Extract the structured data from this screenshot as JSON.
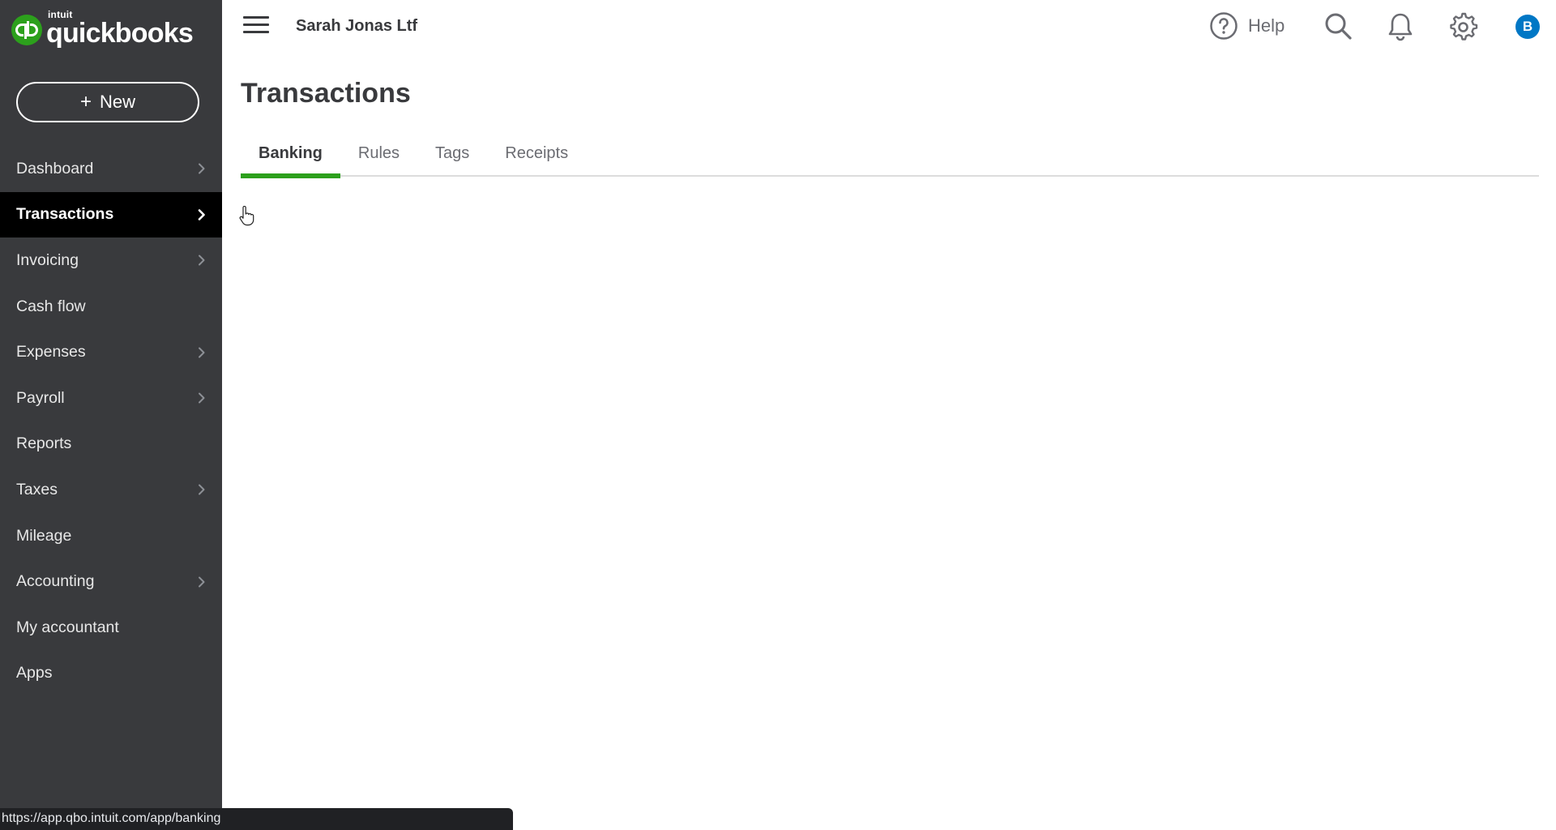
{
  "logo": {
    "small": "intuit",
    "word": "quickbooks"
  },
  "sidebar": {
    "new_label": "New",
    "items": [
      {
        "label": "Dashboard",
        "has_chevron": true
      },
      {
        "label": "Transactions",
        "has_chevron": true,
        "active": true
      },
      {
        "label": "Invoicing",
        "has_chevron": true
      },
      {
        "label": "Cash flow",
        "has_chevron": false
      },
      {
        "label": "Expenses",
        "has_chevron": true
      },
      {
        "label": "Payroll",
        "has_chevron": true
      },
      {
        "label": "Reports",
        "has_chevron": false
      },
      {
        "label": "Taxes",
        "has_chevron": true
      },
      {
        "label": "Mileage",
        "has_chevron": false
      },
      {
        "label": "Accounting",
        "has_chevron": true
      },
      {
        "label": "My accountant",
        "has_chevron": false
      },
      {
        "label": "Apps",
        "has_chevron": false
      }
    ]
  },
  "header": {
    "company": "Sarah Jonas Ltf",
    "help_label": "Help",
    "avatar_initial": "B",
    "icons": [
      "menu-icon",
      "help-icon",
      "search-icon",
      "bell-icon",
      "gear-icon"
    ]
  },
  "main": {
    "title": "Transactions",
    "tabs": [
      {
        "label": "Banking",
        "active": true
      },
      {
        "label": "Rules"
      },
      {
        "label": "Tags"
      },
      {
        "label": "Receipts"
      }
    ]
  },
  "status_bar": {
    "url": "https://app.qbo.intuit.com/app/banking"
  },
  "colors": {
    "sidebar_bg": "#393a3d",
    "sidebar_active": "#000000",
    "brand_green": "#2ca01c",
    "avatar_blue": "#0077c5",
    "text_dark": "#393a3d"
  }
}
